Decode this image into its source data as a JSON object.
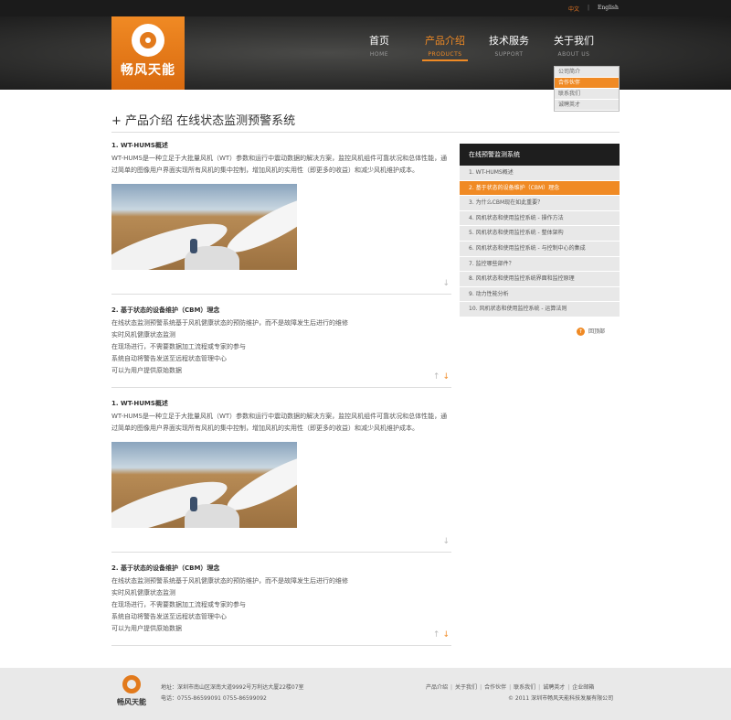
{
  "topbar": {
    "lang_cn": "中文",
    "sep": "|",
    "lang_en": "English"
  },
  "logo": {
    "text": "畅风天能"
  },
  "nav": [
    {
      "cn": "首页",
      "en": "HOME"
    },
    {
      "cn": "产品介绍",
      "en": "PRODUCTS"
    },
    {
      "cn": "技术服务",
      "en": "SUPPORT"
    },
    {
      "cn": "关于我们",
      "en": "ABOUT US"
    }
  ],
  "dropdown": [
    "公司简介",
    "合作伙伴",
    "联系我们",
    "诚聘英才"
  ],
  "page_title": "+ 产品介绍  在线状态监测预警系统",
  "blocks": [
    {
      "title": "1. WT-HUMS概述",
      "body": "WT-HUMS是一种立足于大批量风机（WT）参数和运行中震动数据的解决方案，监控风机组件可靠状况和总体性能，通过简单的图像用户界面实现所有风机的集中控制，增加风机的实用性（即更多的收益）和减少风机维护成本。"
    },
    {
      "title": "2. 基于状态的设备维护（CBM）理念",
      "lines": [
        "在线状态监测预警系统基于风机健康状态的预防维护，而不是故障发生后进行的维修",
        "实时风机健康状态监测",
        "在现场进行，不需要数据加工流程或专家的参与",
        "系统自动将警告发送至远程状态管理中心",
        "可以为用户提供原始数据"
      ]
    },
    {
      "title": "1. WT-HUMS概述",
      "body": "WT-HUMS是一种立足于大批量风机（WT）参数和运行中震动数据的解决方案，监控风机组件可靠状况和总体性能，通过简单的图像用户界面实现所有风机的集中控制，增加风机的实用性（即更多的收益）和减少风机维护成本。"
    },
    {
      "title": "2. 基于状态的设备维护（CBM）理念",
      "lines": [
        "在线状态监测预警系统基于风机健康状态的预防维护，而不是故障发生后进行的维修",
        "实时风机健康状态监测",
        "在现场进行，不需要数据加工流程或专家的参与",
        "系统自动将警告发送至远程状态管理中心",
        "可以为用户提供原始数据"
      ]
    }
  ],
  "arrows": {
    "up": "↑",
    "down": "↓"
  },
  "sidebar": {
    "title": "在线预警监测系统",
    "items": [
      "1. WT-HUMS概述",
      "2. 基于状态的设备维护（CBM）理念",
      "3. 为什么CBM现在如此重要？",
      "4. 风机状态和使用监控系统 - 操作方法",
      "5. 风机状态和使用监控系统 - 整体架构",
      "6. 风机状态和使用监控系统 - 与控制中心的集成",
      "7. 监控哪些部件？",
      "8. 风机状态和使用监控系统界面和监控原理",
      "9. 动力性能分析",
      "10. 风机状态和使用监控系统 - 运算法则"
    ],
    "back": "回顶部",
    "back_icon": "↑"
  },
  "footer": {
    "logo_text": "畅风天能",
    "address": "地址：深圳市南山区深南大道9992号万利达大厦22楼07室",
    "phone": "电话：0755-86599091    0755-86599092",
    "links": [
      "产品介绍",
      "关于我们",
      "合作伙伴",
      "联系我们",
      "诚聘英才",
      "企业邮箱"
    ],
    "copyright": "© 2011 深圳市畅风天能科技发展有限公司"
  },
  "colors": {
    "accent": "#f08a24",
    "dark": "#1e1e1e"
  }
}
